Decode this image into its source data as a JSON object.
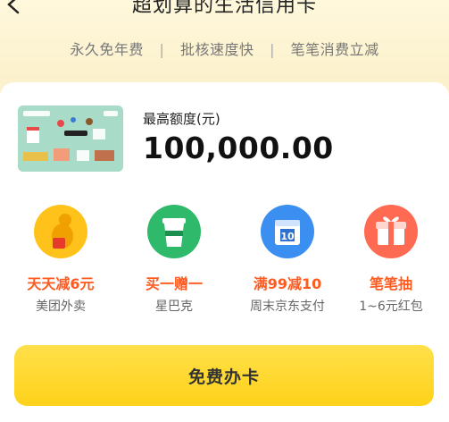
{
  "header": {
    "title": "超划算的生活信用卡",
    "features": [
      "永久免年费",
      "批核速度快",
      "笔笔消费立减"
    ]
  },
  "card": {
    "limit_label": "最高额度(元)",
    "limit_value": "100,000.00"
  },
  "benefits": [
    {
      "title": "天天减6元",
      "subtitle": "美团外卖",
      "icon": "kangaroo-icon"
    },
    {
      "title": "买一赠一",
      "subtitle": "星巴克",
      "icon": "coffee-cup-icon"
    },
    {
      "title": "满99减10",
      "subtitle": "周末京东支付",
      "icon": "calendar-icon"
    },
    {
      "title": "笔笔抽",
      "subtitle": "1~6元红包",
      "icon": "gift-box-icon"
    }
  ],
  "cta": {
    "label": "免费办卡"
  },
  "colors": {
    "accent": "#ff5a1f",
    "button": "#ffd21a",
    "background": "#fbf1cc"
  }
}
